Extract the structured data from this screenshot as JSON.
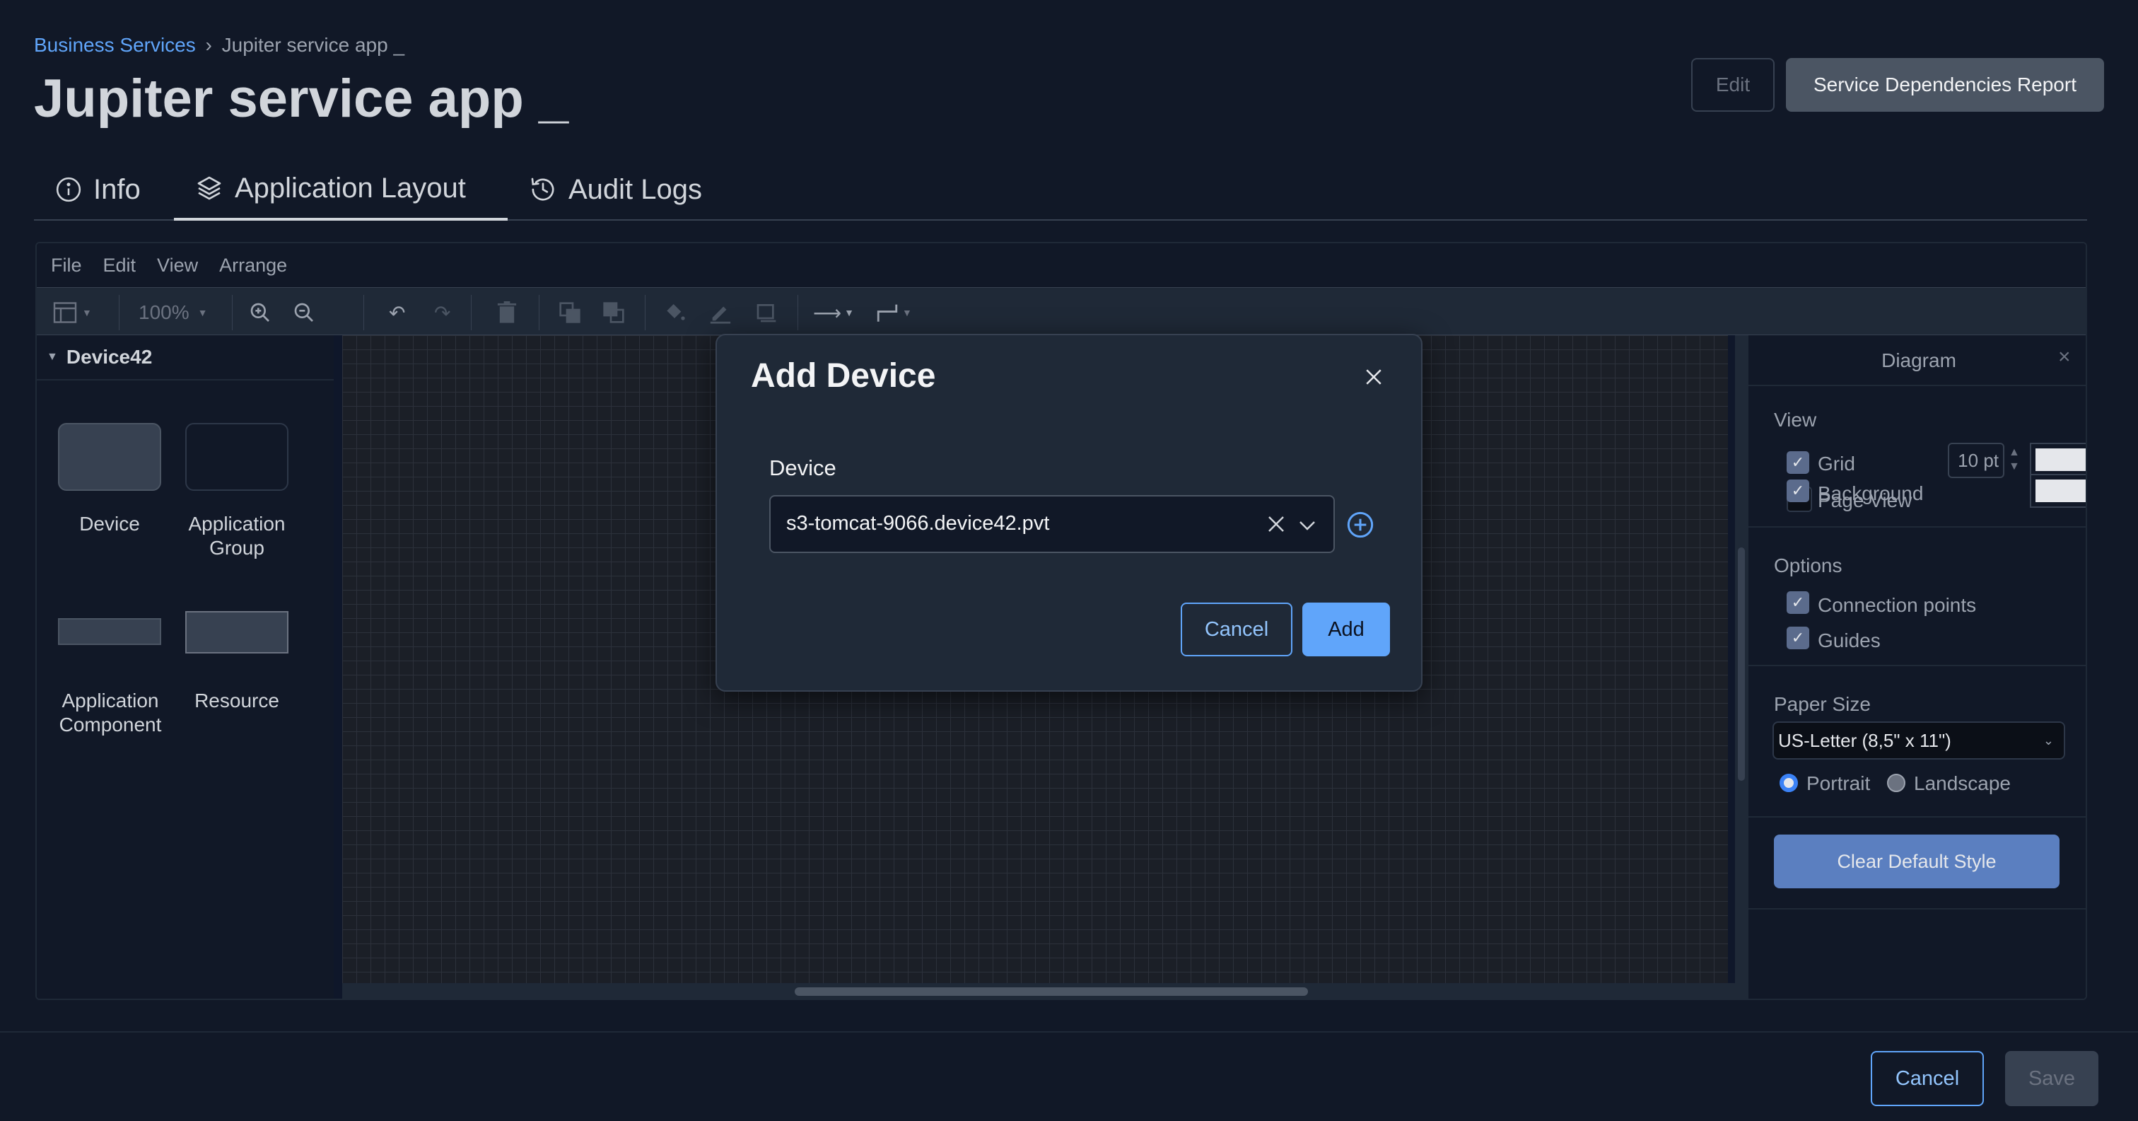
{
  "breadcrumb": {
    "parent": "Business Services",
    "separator": "›",
    "current": "Jupiter service app _"
  },
  "page": {
    "title": "Jupiter service app _"
  },
  "header": {
    "edit_label": "Edit",
    "report_label": "Service Dependencies Report"
  },
  "tabs": [
    {
      "label": "Info",
      "icon": "info-icon"
    },
    {
      "label": "Application Layout",
      "icon": "layers-icon",
      "active": true
    },
    {
      "label": "Audit Logs",
      "icon": "history-icon"
    }
  ],
  "editor": {
    "menu": [
      "File",
      "Edit",
      "View",
      "Arrange"
    ],
    "toolbar": {
      "zoom": "100%"
    },
    "library": {
      "title": "Device42",
      "shapes": [
        {
          "label": "Device"
        },
        {
          "label": "Application Group"
        },
        {
          "label": "Application Component"
        },
        {
          "label": "Resource"
        }
      ]
    }
  },
  "format_panel": {
    "title": "Diagram",
    "view": {
      "heading": "View",
      "grid_label": "Grid",
      "grid_size": "10 pt",
      "page_view_label": "Page View",
      "background_label": "Background"
    },
    "options": {
      "heading": "Options",
      "connection_points_label": "Connection points",
      "guides_label": "Guides"
    },
    "paper": {
      "heading": "Paper Size",
      "selected": "US-Letter (8,5\" x 11\")",
      "portrait_label": "Portrait",
      "landscape_label": "Landscape"
    },
    "clear_style_label": "Clear Default Style"
  },
  "modal": {
    "title": "Add Device",
    "device_label": "Device",
    "device_value": "s3-tomcat-9066.device42.pvt",
    "cancel_label": "Cancel",
    "add_label": "Add"
  },
  "footer": {
    "cancel_label": "Cancel",
    "save_label": "Save"
  },
  "colors": {
    "accent": "#5b8def",
    "primary_button": "#60a5fa",
    "muted_button": "#4b5563"
  }
}
